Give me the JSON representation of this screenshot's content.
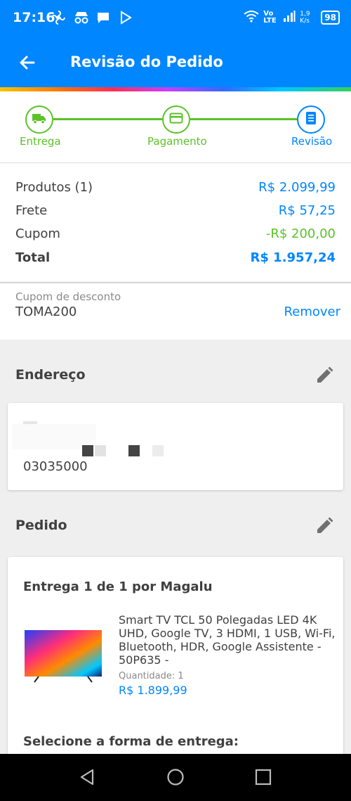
{
  "status": {
    "time": "17:16",
    "network": "Vo LTE",
    "speed": "1,9 K/s",
    "battery": "98"
  },
  "header": {
    "title": "Revisão do Pedido"
  },
  "stepper": {
    "steps": [
      {
        "label": "Entrega",
        "icon": "truck-icon",
        "state": "done"
      },
      {
        "label": "Pagamento",
        "icon": "card-icon",
        "state": "done"
      },
      {
        "label": "Revisão",
        "icon": "receipt-icon",
        "state": "active"
      }
    ]
  },
  "summary": {
    "products_label": "Produtos (1)",
    "products_value": "R$ 2.099,99",
    "shipping_label": "Frete",
    "shipping_value": "R$ 57,25",
    "coupon_label": "Cupom",
    "coupon_value": "-R$ 200,00",
    "total_label": "Total",
    "total_value": "R$ 1.957,24"
  },
  "coupon": {
    "label": "Cupom de desconto",
    "code": "TOMA200",
    "remove_label": "Remover"
  },
  "address": {
    "title": "Endereço",
    "cep": "03035000"
  },
  "order": {
    "title": "Pedido",
    "delivery": "Entrega 1 de 1 por Magalu",
    "product_name": "Smart TV TCL 50 Polegadas LED 4K UHD, Google TV, 3 HDMI, 1 USB, Wi-Fi, Bluetooth, HDR, Google Assistente - 50P635 -",
    "quantity": "Quantidade:  1",
    "price": "R$ 1.899,99",
    "select_delivery": "Selecione a forma de entrega:"
  },
  "colors": {
    "primary": "#0086ff",
    "success": "#5bc228"
  }
}
